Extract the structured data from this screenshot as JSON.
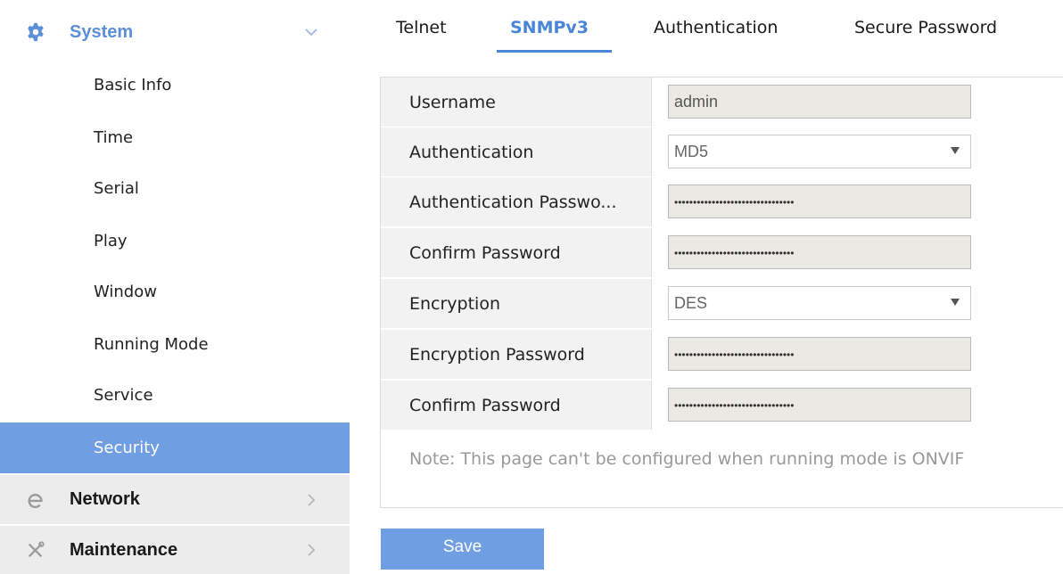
{
  "sidebar": {
    "system": {
      "label": "System",
      "icon": "gear-icon",
      "chevron": "chevron-down-icon"
    },
    "items": [
      {
        "label": "Basic Info"
      },
      {
        "label": "Time"
      },
      {
        "label": "Serial"
      },
      {
        "label": "Play"
      },
      {
        "label": "Window"
      },
      {
        "label": "Running Mode"
      },
      {
        "label": "Service"
      },
      {
        "label": "Security",
        "active": true
      }
    ],
    "network": {
      "label": "Network",
      "icon": "network-e-icon",
      "chevron": "chevron-right-icon"
    },
    "maintenance": {
      "label": "Maintenance",
      "icon": "tools-icon",
      "chevron": "chevron-right-icon"
    }
  },
  "tabs": [
    {
      "label": "Telnet"
    },
    {
      "label": "SNMPv3",
      "active": true
    },
    {
      "label": "Authentication"
    },
    {
      "label": "Secure Password"
    }
  ],
  "form": {
    "rows": [
      {
        "label": "Username",
        "type": "text",
        "value": "admin"
      },
      {
        "label": "Authentication",
        "type": "select",
        "value": "MD5"
      },
      {
        "label": "Authentication Passwo...",
        "type": "password",
        "value": "••••••••••••••••••••••••••••••••"
      },
      {
        "label": "Confirm Password",
        "type": "password",
        "value": "••••••••••••••••••••••••••••••••"
      },
      {
        "label": "Encryption",
        "type": "select",
        "value": "DES"
      },
      {
        "label": "Encryption Password",
        "type": "password",
        "value": "••••••••••••••••••••••••••••••••"
      },
      {
        "label": "Confirm Password",
        "type": "password",
        "value": "••••••••••••••••••••••••••••••••"
      }
    ],
    "note": "Note: This page can't be configured when running mode is ONVIF"
  },
  "actions": {
    "save_label": "Save"
  },
  "colors": {
    "accent": "#6f9ee3",
    "active_tab": "#4a86d8",
    "label_bg": "#f2f2f2",
    "input_bg": "#ebe9e3",
    "note_text": "#999999"
  }
}
